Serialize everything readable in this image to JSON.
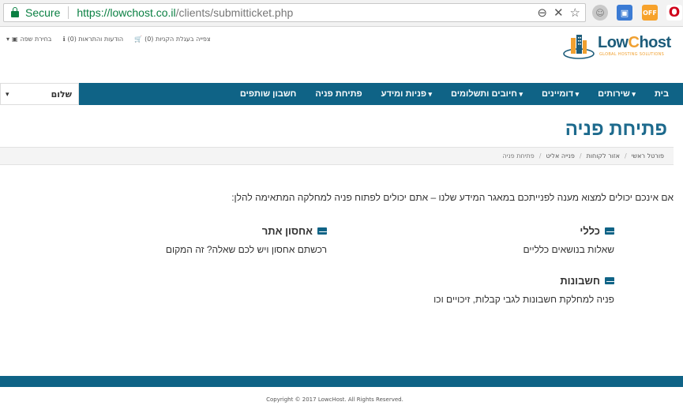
{
  "browser": {
    "secure_label": "Secure",
    "url_base": "https://lowchost.co.il",
    "url_path": "/clients/submitticket.php",
    "ext_badge": "OFF"
  },
  "topbar": {
    "cart": "צפייה בעגלת הקניות (0)",
    "notifications": "הודעות והתראות (0)",
    "language": "בחירת שפה"
  },
  "logo": {
    "text_a": "Low",
    "text_b": "C",
    "text_c": "host",
    "subtitle": "GLOBAL HOSTING SOLUTIONS"
  },
  "nav": {
    "items": [
      "בית",
      "שירותים",
      "דומיינים",
      "חיובים ותשלומים",
      "פניות ומידע",
      "פתיחת פניה",
      "חשבון שותפים"
    ],
    "user_greeting": "שלום"
  },
  "page": {
    "title": "פתיחת פניה",
    "breadcrumb": [
      "פורטל ראשי",
      "אזור לקוחות",
      "פנייה אליט",
      "פתיחת פניה"
    ],
    "intro": "אם אינכם יכולים למצוא מענה לפנייתכם במאגר המידע שלנו – אתם יכולים לפתוח פניה למחלקה המתאימה להלן:",
    "departments": [
      {
        "name": "כללי",
        "description": "שאלות בנושאים כלליים"
      },
      {
        "name": "אחסון אתר",
        "description": "רכשתם אחסון ויש לכם שאלה? זה המקום"
      },
      {
        "name": "חשבונות",
        "description": "פניה למחלקת חשבונות לגבי קבלות, זיכויים וכו"
      }
    ]
  },
  "footer": {
    "copyright": "Copyright © 2017 LowcHost. All Rights Reserved."
  },
  "colors": {
    "brand": "#0f6386",
    "title": "#1d6a8d",
    "secure_green": "#0b8043",
    "logo_orange": "#f0a030"
  }
}
